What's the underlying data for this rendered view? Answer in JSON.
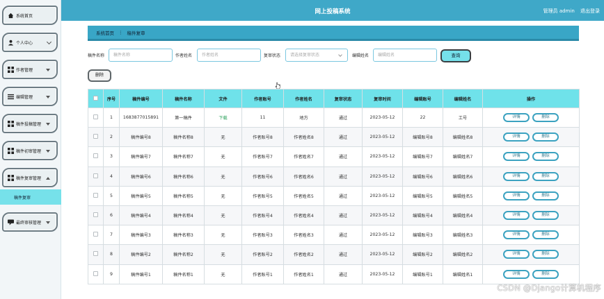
{
  "header": {
    "title": "网上投稿系统",
    "user_label": "管理员 admin",
    "logout": "退出登录"
  },
  "sidebar": {
    "items": [
      {
        "label": "系统首页",
        "icon": "home-icon"
      },
      {
        "label": "个人中心",
        "icon": "user-icon"
      },
      {
        "label": "作者管理",
        "icon": "grid-icon"
      },
      {
        "label": "编辑管理",
        "icon": "list-icon"
      },
      {
        "label": "稿件投稿管理",
        "icon": "grid-icon"
      },
      {
        "label": "稿件初审管理",
        "icon": "grid-icon"
      },
      {
        "label": "稿件复审管理",
        "icon": "grid-icon"
      },
      {
        "label": "最终审核管理",
        "icon": "chat-icon"
      }
    ],
    "sub_item": "稿件复审"
  },
  "breadcrumb": {
    "home": "系统首页",
    "separator": "⋮",
    "current": "稿件复审"
  },
  "search": {
    "f1_label": "稿件名称",
    "f1_placeholder": "稿件名称",
    "f2_label": "作者姓名",
    "f2_placeholder": "作者姓名",
    "f3_label": "复审状态",
    "f3_placeholder": "请选择复审状态",
    "f4_label": "编辑姓名",
    "f4_placeholder": "编辑姓名",
    "query_button": "查询",
    "delete_button": "删除"
  },
  "table": {
    "headers": [
      "",
      "序号",
      "稿件编号",
      "稿件名称",
      "文件",
      "作者账号",
      "作者姓名",
      "复审状态",
      "复审时间",
      "编辑账号",
      "编辑姓名",
      "操作"
    ],
    "detail_label": "详情",
    "delete_label": "删除",
    "rows": [
      [
        "1",
        "1683877015891",
        "第一稿件",
        "下载",
        "11",
        "地方",
        "通过",
        "2023-05-12",
        "22",
        "工号"
      ],
      [
        "2",
        "稿件编号8",
        "稿件名称8",
        "无",
        "作者账号8",
        "作者姓名8",
        "通过",
        "2023-05-12",
        "编辑账号8",
        "编辑姓名8"
      ],
      [
        "3",
        "稿件编号7",
        "稿件名称7",
        "无",
        "作者账号7",
        "作者姓名7",
        "通过",
        "2023-05-12",
        "编辑账号7",
        "编辑姓名7"
      ],
      [
        "4",
        "稿件编号6",
        "稿件名称6",
        "无",
        "作者账号6",
        "作者姓名6",
        "通过",
        "2023-05-12",
        "编辑账号6",
        "编辑姓名6"
      ],
      [
        "5",
        "稿件编号5",
        "稿件名称5",
        "无",
        "作者账号5",
        "作者姓名5",
        "通过",
        "2023-05-12",
        "编辑账号5",
        "编辑姓名5"
      ],
      [
        "6",
        "稿件编号4",
        "稿件名称4",
        "无",
        "作者账号4",
        "作者姓名4",
        "通过",
        "2023-05-12",
        "编辑账号4",
        "编辑姓名4"
      ],
      [
        "7",
        "稿件编号3",
        "稿件名称3",
        "无",
        "作者账号3",
        "作者姓名3",
        "通过",
        "2023-05-12",
        "编辑账号3",
        "编辑姓名3"
      ],
      [
        "8",
        "稿件编号2",
        "稿件名称2",
        "无",
        "作者账号2",
        "作者姓名2",
        "通过",
        "2023-05-12",
        "编辑账号2",
        "编辑姓名2"
      ],
      [
        "9",
        "稿件编号1",
        "稿件名称1",
        "无",
        "作者账号1",
        "作者姓名1",
        "通过",
        "2023-05-12",
        "编辑账号1",
        "编辑姓名1"
      ]
    ]
  },
  "watermark": "CSDN @Django计算机程序",
  "colors": {
    "header": "#3fa8c8",
    "accent": "#6fe2ea",
    "download": "#2aa15a"
  }
}
